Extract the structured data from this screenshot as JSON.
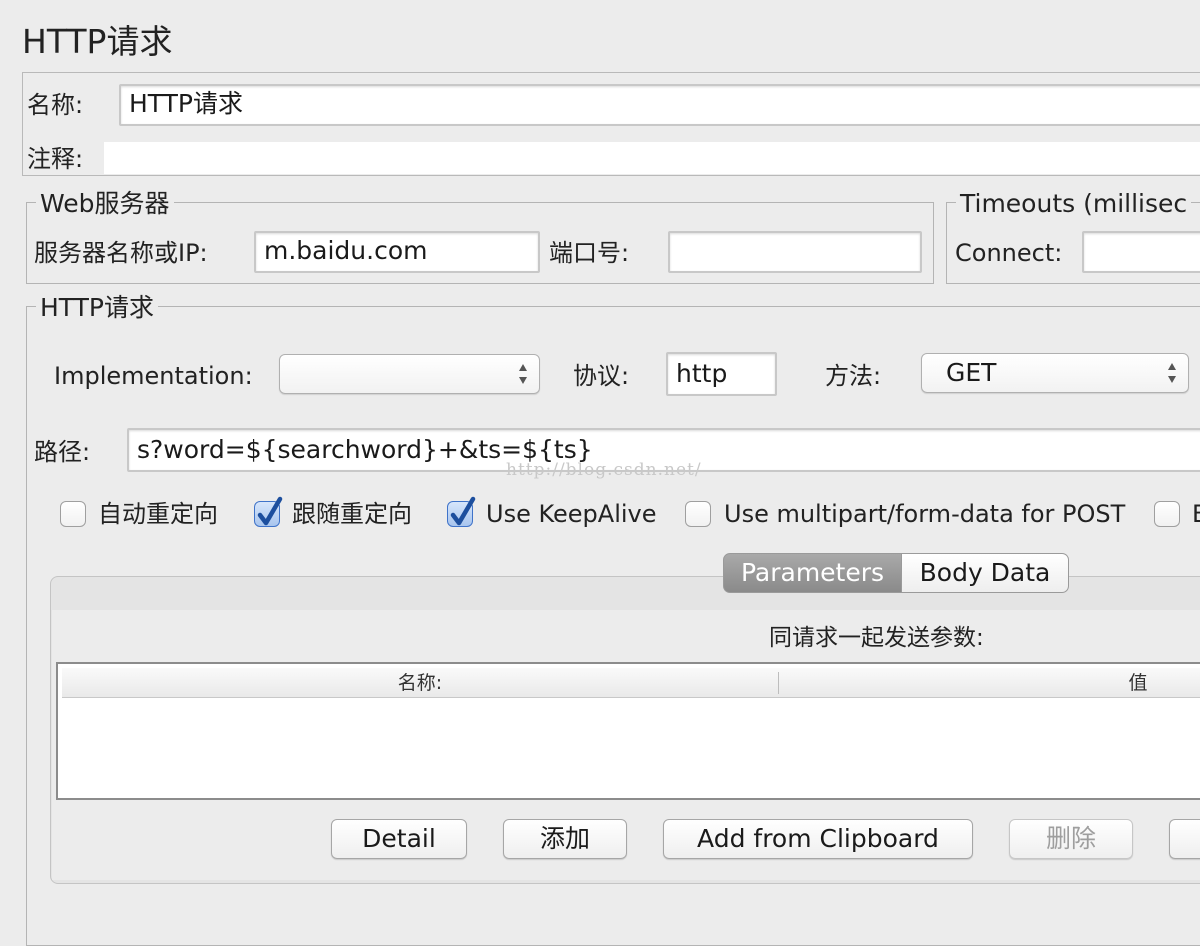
{
  "window": {
    "title": "HTTP请求"
  },
  "name_panel": {
    "name_label": "名称:",
    "name_value": "HTTP请求",
    "comment_label": "注释:",
    "comment_value": ""
  },
  "web_server": {
    "legend": "Web服务器",
    "server_label": "服务器名称或IP:",
    "server_value": "m.baidu.com",
    "port_label": "端口号:",
    "port_value": ""
  },
  "timeouts": {
    "legend": "Timeouts (millisec",
    "connect_label": "Connect:",
    "connect_value": ""
  },
  "http_request": {
    "legend": "HTTP请求",
    "implementation_label": "Implementation:",
    "implementation_value": "",
    "protocol_label": "协议:",
    "protocol_value": "http",
    "method_label": "方法:",
    "method_value": "GET",
    "path_label": "路径:",
    "path_value": "s?word=${searchword}+&ts=${ts}",
    "watermark": "http://blog.csdn.net/"
  },
  "options": [
    {
      "label": "自动重定向",
      "checked": false
    },
    {
      "label": "跟随重定向",
      "checked": true
    },
    {
      "label": "Use KeepAlive",
      "checked": true
    },
    {
      "label": "Use multipart/form-data for POST",
      "checked": false
    },
    {
      "label": "B",
      "checked": false
    }
  ],
  "tabs": {
    "parameters": "Parameters",
    "body_data": "Body Data",
    "active": "Parameters"
  },
  "params": {
    "caption": "同请求一起发送参数:",
    "columns": [
      "名称:",
      "值"
    ],
    "rows": []
  },
  "buttons": {
    "detail": "Detail",
    "add": "添加",
    "add_from_clipboard": "Add from Clipboard",
    "delete": "删除",
    "delete_enabled": false
  },
  "colors": {
    "background": "#ececec",
    "active_tab": "#9a9a9a",
    "checkbox_checked": "#2b5fb5"
  }
}
